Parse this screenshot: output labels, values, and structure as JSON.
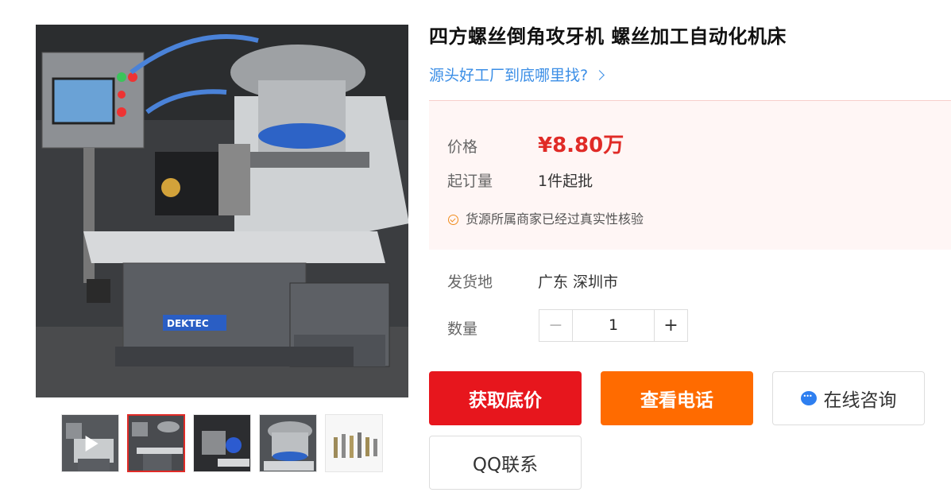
{
  "product": {
    "title": "四方螺丝倒角攻牙机 螺丝加工自动化机床",
    "source_link": "源头好工厂到底哪里找?",
    "price_label": "价格",
    "price": "¥8.80万",
    "moq_label": "起订量",
    "moq": "1件起批",
    "verify_text": "货源所属商家已经过真实性核验",
    "ship_label": "发货地",
    "ship_from": "广东 深圳市",
    "qty_label": "数量",
    "qty_value": "1",
    "qty_minus": "−",
    "qty_plus": "+"
  },
  "image": {
    "brand_plate": "DEKTEC"
  },
  "actions": {
    "lowest_price": "获取底价",
    "view_phone": "查看电话",
    "online_chat": "在线咨询",
    "qq_contact": "QQ联系"
  },
  "colors": {
    "accent_red": "#e7161d",
    "accent_orange": "#ff6b00",
    "link_blue": "#3b8ee6",
    "price_red": "#e02b27"
  },
  "thumbnails": [
    "video-thumb",
    "machine-front",
    "machine-detail",
    "feeder-bowl",
    "screw-samples"
  ]
}
